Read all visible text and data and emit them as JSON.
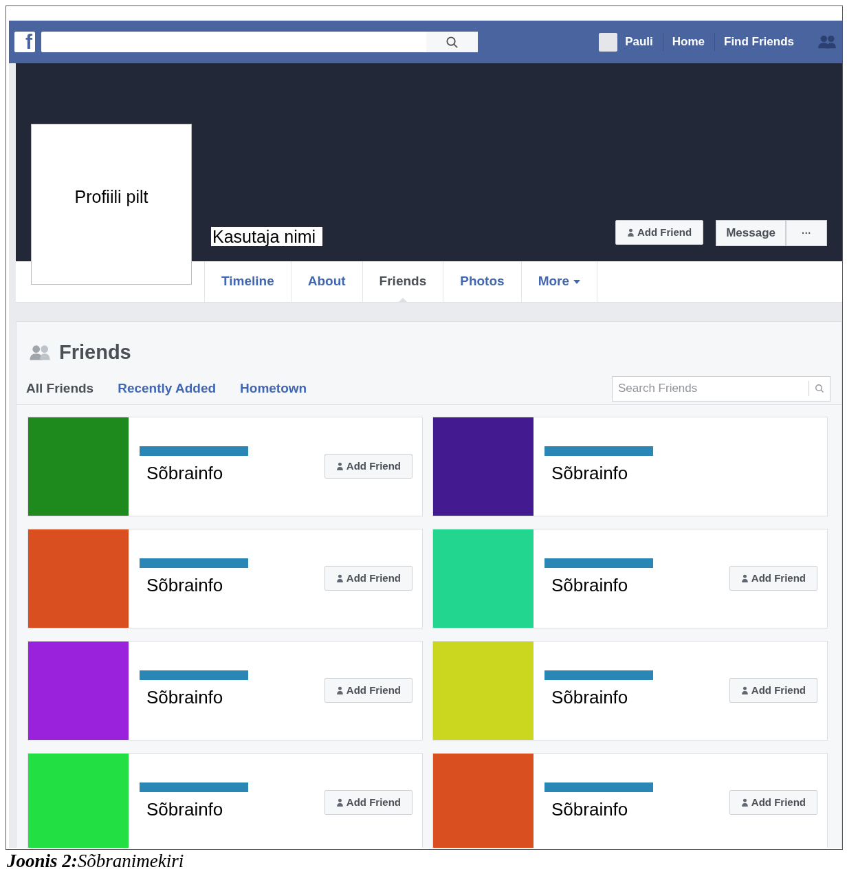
{
  "topbar": {
    "logo": "f",
    "user": "Pauli",
    "nav": [
      "Home",
      "Find Friends"
    ]
  },
  "profile": {
    "picture_label": "Profiili pilt",
    "name": "Kasutaja nimi",
    "buttons": [
      {
        "label": "Add Friend",
        "kind": "add"
      },
      {
        "label": "Message",
        "kind": "plain"
      },
      {
        "label": "···",
        "kind": "more"
      }
    ]
  },
  "tabs": [
    {
      "label": "Timeline",
      "selected": false
    },
    {
      "label": "About",
      "selected": false
    },
    {
      "label": "Friends",
      "selected": true
    },
    {
      "label": "Photos",
      "selected": false
    },
    {
      "label": "More",
      "selected": false,
      "kind": "menu"
    }
  ],
  "friends": {
    "title": "Friends",
    "filters": [
      {
        "label": "All Friends",
        "selected": true
      },
      {
        "label": "Recently Added",
        "selected": false
      },
      {
        "label": "Hometown",
        "selected": false
      }
    ],
    "search": {
      "placeholder": "Search Friends"
    },
    "cards": [
      {
        "color": "#1e8a1e",
        "info": "Sõbrainfo",
        "button": "Add Friend"
      },
      {
        "color": "#431a8f",
        "info": "Sõbrainfo"
      },
      {
        "color": "#d94f20",
        "info": "Sõbrainfo",
        "button": "Add Friend"
      },
      {
        "color": "#22d68f",
        "info": "Sõbrainfo",
        "button": "Add Friend"
      },
      {
        "color": "#9b22dd",
        "info": "Sõbrainfo",
        "button": "Add Friend"
      },
      {
        "color": "#cbd61e",
        "info": "Sõbrainfo",
        "button": "Add Friend"
      },
      {
        "color": "#22e044",
        "info": "Sõbrainfo",
        "button": "Add Friend"
      },
      {
        "color": "#d94f20",
        "info": "Sõbrainfo",
        "button": "Add Friend"
      }
    ]
  },
  "caption": "**Joonis 2:**Sõbranimekiri"
}
